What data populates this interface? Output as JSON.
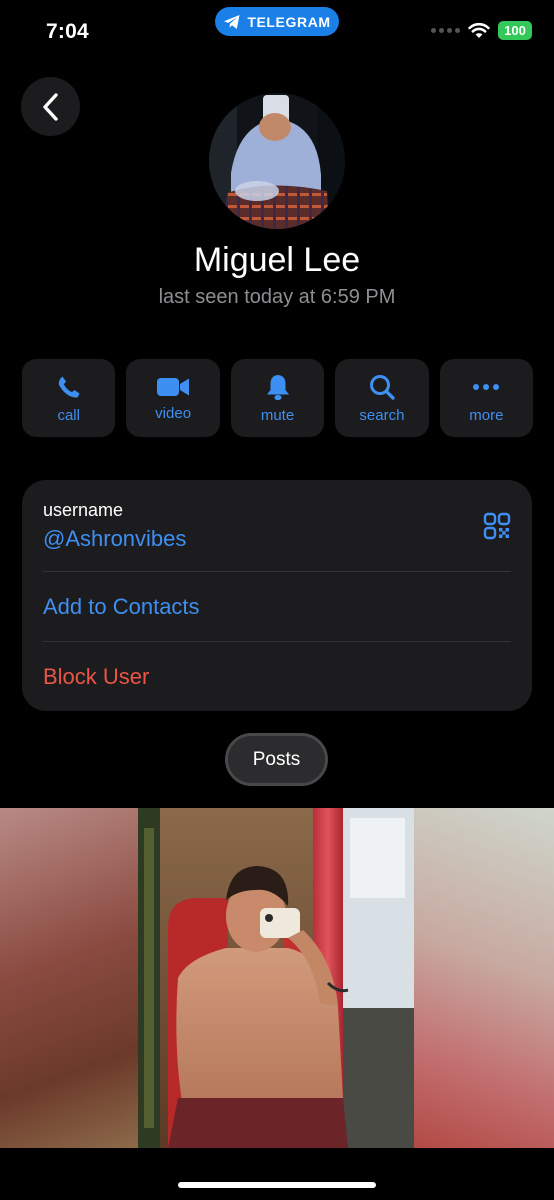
{
  "status_bar": {
    "time": "7:04",
    "app_pill": "TELEGRAM",
    "battery": "100"
  },
  "profile": {
    "name": "Miguel Lee",
    "last_seen": "last seen today at 6:59 PM"
  },
  "actions": [
    {
      "label": "call",
      "icon": "phone-icon"
    },
    {
      "label": "video",
      "icon": "video-camera-icon"
    },
    {
      "label": "mute",
      "icon": "bell-icon"
    },
    {
      "label": "search",
      "icon": "search-icon"
    },
    {
      "label": "more",
      "icon": "more-dots-icon"
    }
  ],
  "info": {
    "username_label": "username",
    "username": "@Ashronvibes",
    "add_to_contacts": "Add to Contacts",
    "block_user": "Block User"
  },
  "tabs": {
    "posts": "Posts"
  },
  "colors": {
    "accent": "#3e8ff2",
    "danger": "#eb5545",
    "card": "#1c1c1e",
    "battery": "#34c759",
    "pill": "#1a7fe6"
  }
}
